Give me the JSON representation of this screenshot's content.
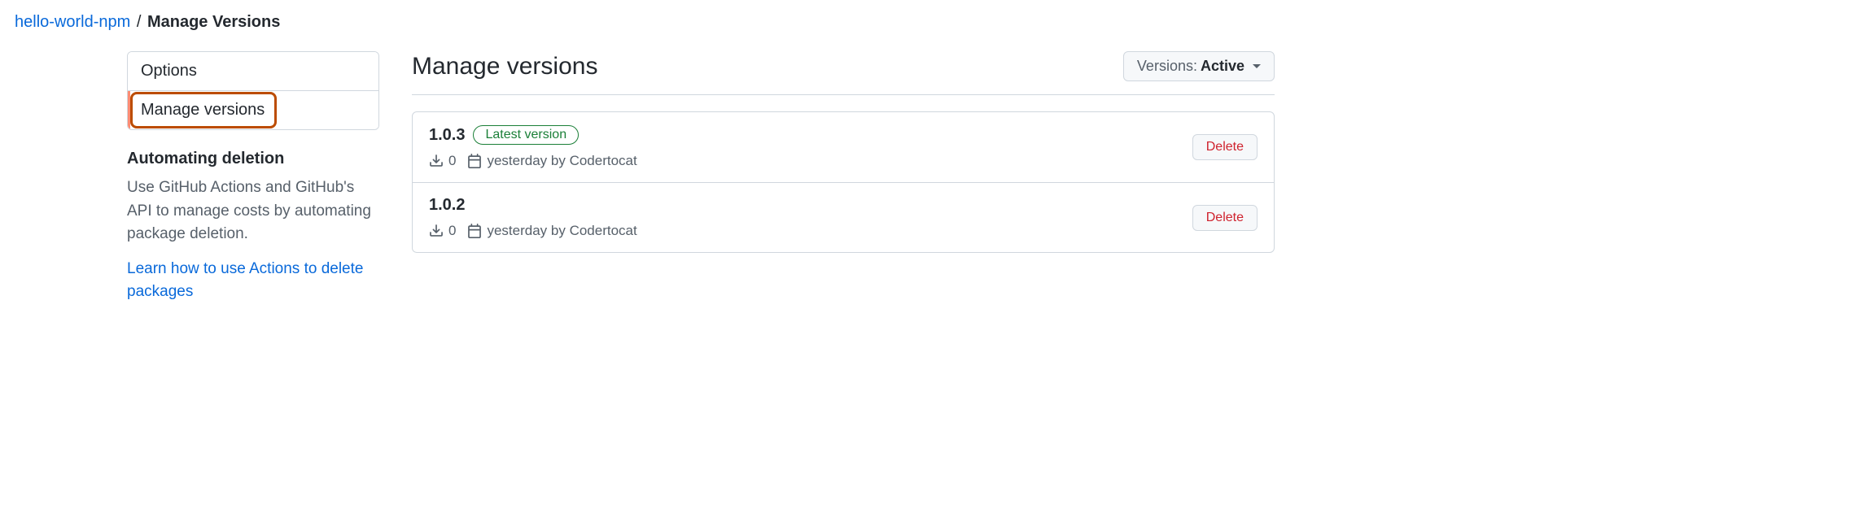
{
  "breadcrumb": {
    "parent": "hello-world-npm",
    "separator": "/",
    "current": "Manage Versions"
  },
  "sidebar": {
    "nav": [
      {
        "label": "Options",
        "active": false
      },
      {
        "label": "Manage versions",
        "active": true
      }
    ],
    "automating": {
      "title": "Automating deletion",
      "description": "Use GitHub Actions and GitHub's API to manage costs by automating package deletion.",
      "link": "Learn how to use Actions to delete packages"
    }
  },
  "main": {
    "title": "Manage versions",
    "filter": {
      "label": "Versions:",
      "value": "Active"
    },
    "versions": [
      {
        "number": "1.0.3",
        "latest_badge": "Latest version",
        "downloads": "0",
        "published": "yesterday by Codertocat",
        "delete_label": "Delete"
      },
      {
        "number": "1.0.2",
        "latest_badge": null,
        "downloads": "0",
        "published": "yesterday by Codertocat",
        "delete_label": "Delete"
      }
    ]
  }
}
